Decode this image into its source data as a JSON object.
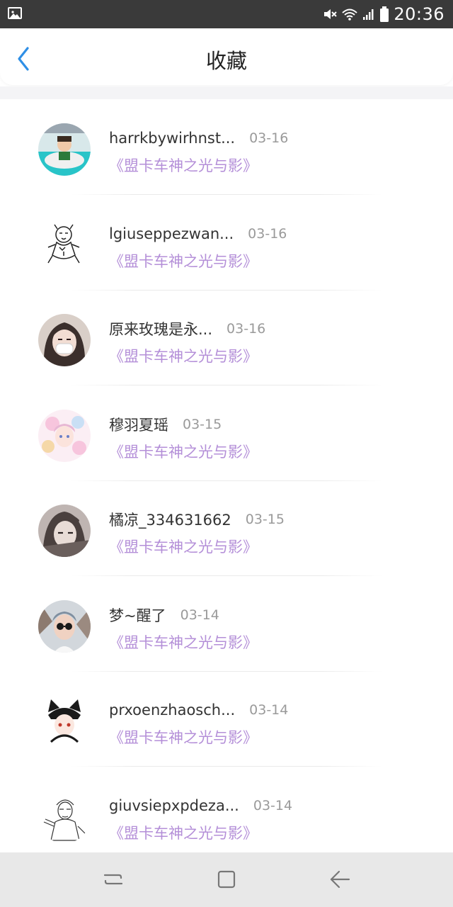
{
  "status_bar": {
    "time": "20:36",
    "icons": [
      "image-icon",
      "mute-icon",
      "wifi-icon",
      "signal-icon",
      "battery-icon"
    ]
  },
  "header": {
    "title": "收藏",
    "back_icon": "chevron-left-icon",
    "accent_color": "#2f8fe6"
  },
  "items": [
    {
      "name": "harrkbywirhnst...",
      "date": "03-16",
      "title": "《盟卡车神之光与影》",
      "avatar": "photo-child-pool"
    },
    {
      "name": "lgiuseppezwan...",
      "date": "03-16",
      "title": "《盟卡车神之光与影》",
      "avatar": "sketch-tiger"
    },
    {
      "name": "原来玫瑰是永...",
      "date": "03-16",
      "title": "《盟卡车神之光与影》",
      "avatar": "anime-mask-girl"
    },
    {
      "name": "穆羽夏瑶",
      "date": "03-15",
      "title": "《盟卡车神之光与影》",
      "avatar": "anime-pink-girl"
    },
    {
      "name": "橘凉_334631662",
      "date": "03-15",
      "title": "《盟卡车神之光与影》",
      "avatar": "anime-dark-boy"
    },
    {
      "name": "梦~醒了",
      "date": "03-14",
      "title": "《盟卡车神之光与影》",
      "avatar": "photo-sunglasses"
    },
    {
      "name": "prxoenzhaosch...",
      "date": "03-14",
      "title": "《盟卡车神之光与影》",
      "avatar": "anime-cat-ears"
    },
    {
      "name": "giuvsiepxpdeza...",
      "date": "03-14",
      "title": "《盟卡车神之光与影》",
      "avatar": "sketch-boy"
    }
  ],
  "colors": {
    "favorite_title": "#b48fd8",
    "date": "#9a9a9a",
    "name": "#333333"
  },
  "nav_bar": {
    "buttons": [
      "recent-apps-icon",
      "home-icon",
      "back-arrow-icon"
    ]
  }
}
